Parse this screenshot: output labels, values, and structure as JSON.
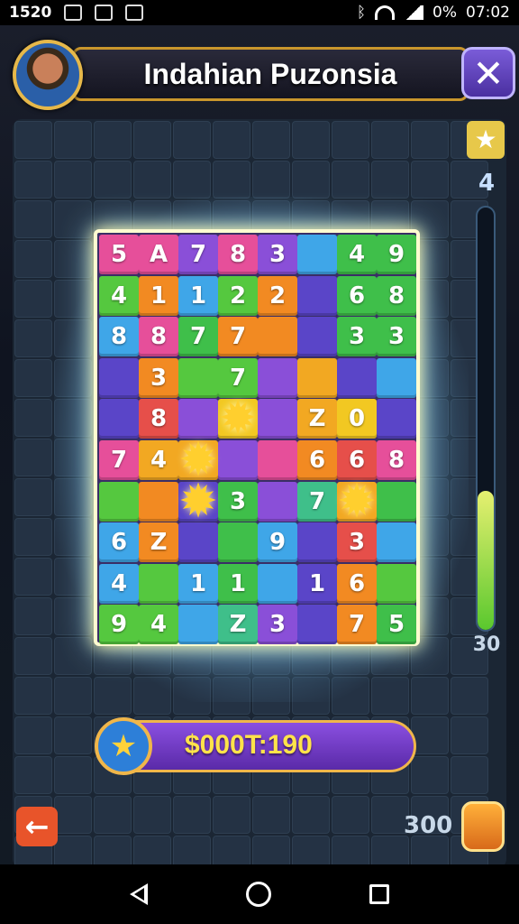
{
  "status_bar": {
    "left_time": "1520",
    "battery": "0%",
    "clock": "07:02"
  },
  "header": {
    "title": "Indahian Puzonsia",
    "close_glyph": "✕",
    "avatar_icon": "player-avatar"
  },
  "side": {
    "top_icon_glyph": "★",
    "level": "4",
    "meter_value": "30",
    "meter_fill_fraction": 0.33
  },
  "board": {
    "rows": [
      [
        {
          "t": "5",
          "c": "#e64f9a"
        },
        {
          "t": "A",
          "c": "#e64f9a"
        },
        {
          "t": "7",
          "c": "#8a4fd8"
        },
        {
          "t": "8",
          "c": "#e64f9a"
        },
        {
          "t": "3",
          "c": "#8a4fd8"
        },
        {
          "t": "",
          "c": "#3fa6e8"
        },
        {
          "t": "4",
          "c": "#3fbf4a"
        },
        {
          "t": "9",
          "c": "#3fbf4a"
        }
      ],
      [
        {
          "t": "4",
          "c": "#55c83f"
        },
        {
          "t": "1",
          "c": "#f28a22"
        },
        {
          "t": "1",
          "c": "#3fa6e8"
        },
        {
          "t": "2",
          "c": "#55c83f"
        },
        {
          "t": "2",
          "c": "#f28a22"
        },
        {
          "t": "",
          "c": "#5a45c8"
        },
        {
          "t": "6",
          "c": "#3fbf4a"
        },
        {
          "t": "8",
          "c": "#3fbf4a"
        }
      ],
      [
        {
          "t": "8",
          "c": "#3fa6e8"
        },
        {
          "t": "8",
          "c": "#e64f9a"
        },
        {
          "t": "7",
          "c": "#3fbf4a"
        },
        {
          "t": "7",
          "c": "#f28a22"
        },
        {
          "t": "",
          "c": "#f28a22"
        },
        {
          "t": "",
          "c": "#5a45c8"
        },
        {
          "t": "3",
          "c": "#3fbf4a"
        },
        {
          "t": "3",
          "c": "#3fbf4a"
        }
      ],
      [
        {
          "t": "",
          "c": "#5a45c8"
        },
        {
          "t": "3",
          "c": "#f28a22"
        },
        {
          "t": "",
          "c": "#55c83f"
        },
        {
          "t": "7",
          "c": "#55c83f"
        },
        {
          "t": "",
          "c": "#8a4fd8"
        },
        {
          "t": "",
          "c": "#f2a822"
        },
        {
          "t": "",
          "c": "#5a45c8"
        },
        {
          "t": "",
          "c": "#3fa6e8"
        }
      ],
      [
        {
          "t": "",
          "c": "#5a45c8"
        },
        {
          "t": "8",
          "c": "#e64f4a"
        },
        {
          "t": "",
          "c": "#8a4fd8"
        },
        {
          "t": "",
          "c": "#f2c822"
        },
        {
          "t": "",
          "c": "#8a4fd8"
        },
        {
          "t": "Z",
          "c": "#f2a822"
        },
        {
          "t": "0",
          "c": "#f2c822"
        },
        {
          "t": "",
          "c": "#5a45c8"
        }
      ],
      [
        {
          "t": "7",
          "c": "#e64f9a"
        },
        {
          "t": "4",
          "c": "#f2a822"
        },
        {
          "t": "",
          "c": "#f2a822"
        },
        {
          "t": "",
          "c": "#8a4fd8"
        },
        {
          "t": "",
          "c": "#e64f9a"
        },
        {
          "t": "6",
          "c": "#f28a22"
        },
        {
          "t": "6",
          "c": "#e64f4a"
        },
        {
          "t": "8",
          "c": "#e64f9a"
        }
      ],
      [
        {
          "t": "",
          "c": "#55c83f"
        },
        {
          "t": "",
          "c": "#f28a22"
        },
        {
          "t": "",
          "c": "#5a45c8"
        },
        {
          "t": "3",
          "c": "#3fbf4a"
        },
        {
          "t": "",
          "c": "#8a4fd8"
        },
        {
          "t": "7",
          "c": "#3fbf8a"
        },
        {
          "t": "",
          "c": "#f2a822"
        },
        {
          "t": "",
          "c": "#3fbf4a"
        }
      ],
      [
        {
          "t": "6",
          "c": "#3fa6e8"
        },
        {
          "t": "Z",
          "c": "#f28a22"
        },
        {
          "t": "",
          "c": "#5a45c8"
        },
        {
          "t": "",
          "c": "#3fbf4a"
        },
        {
          "t": "9",
          "c": "#3fa6e8"
        },
        {
          "t": "",
          "c": "#5a45c8"
        },
        {
          "t": "3",
          "c": "#e64f4a"
        },
        {
          "t": "",
          "c": "#3fa6e8"
        }
      ],
      [
        {
          "t": "4",
          "c": "#3fa6e8"
        },
        {
          "t": "",
          "c": "#55c83f"
        },
        {
          "t": "1",
          "c": "#3fa6e8"
        },
        {
          "t": "1",
          "c": "#3fbf4a"
        },
        {
          "t": "",
          "c": "#3fa6e8"
        },
        {
          "t": "1",
          "c": "#5a45c8"
        },
        {
          "t": "6",
          "c": "#f28a22"
        },
        {
          "t": "",
          "c": "#55c83f"
        }
      ],
      [
        {
          "t": "9",
          "c": "#55c83f"
        },
        {
          "t": "4",
          "c": "#55c83f"
        },
        {
          "t": "",
          "c": "#3fa6e8"
        },
        {
          "t": "Z",
          "c": "#3fbf8a"
        },
        {
          "t": "3",
          "c": "#8a4fd8"
        },
        {
          "t": "",
          "c": "#5a45c8"
        },
        {
          "t": "7",
          "c": "#f28a22"
        },
        {
          "t": "5",
          "c": "#3fbf4a"
        }
      ]
    ],
    "bursts": [
      {
        "r": 4,
        "col": 3
      },
      {
        "r": 5,
        "col": 2
      },
      {
        "r": 6,
        "col": 2
      },
      {
        "r": 6,
        "col": 6
      }
    ]
  },
  "score": {
    "text": "$000T:190",
    "icon_glyph": "★"
  },
  "bottom": {
    "back_glyph": "←",
    "moves": "300"
  },
  "navbar": {
    "back_icon": "nav-back-icon",
    "home_icon": "nav-home-icon",
    "recent_icon": "nav-recent-icon"
  }
}
